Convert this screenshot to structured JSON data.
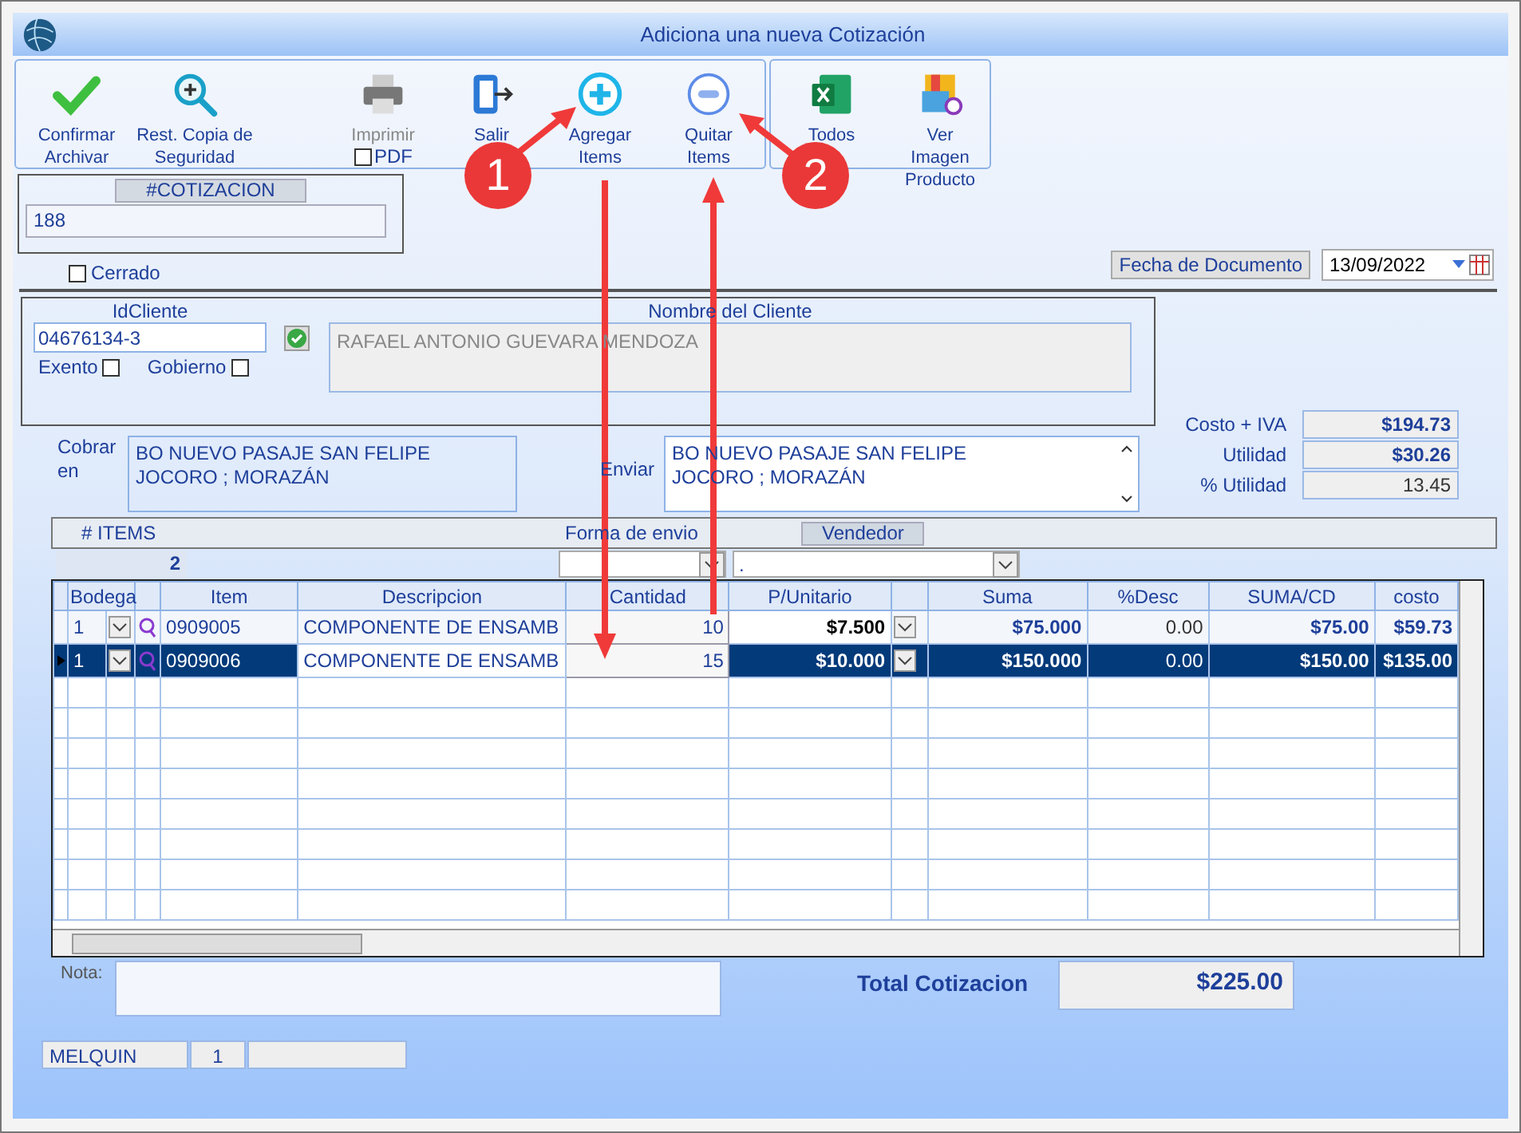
{
  "window": {
    "title": "Adiciona una nueva Cotización"
  },
  "toolbar": {
    "groups": [
      {
        "buttons": [
          {
            "label": "Confirmar Archivar",
            "disabled": false
          },
          {
            "label": "Rest. Copia de Seguridad",
            "disabled": false
          },
          {
            "label": "Imprimir",
            "disabled": true,
            "checkbox": {
              "label": "PDF",
              "checked": false
            }
          },
          {
            "label": "Salir",
            "disabled": false
          },
          {
            "label": "Agregar Items",
            "disabled": false
          },
          {
            "label": "Quitar Items",
            "disabled": false
          }
        ]
      },
      {
        "buttons": [
          {
            "label": "Todos",
            "disabled": false
          },
          {
            "label": "Ver Imagen Producto",
            "disabled": false
          }
        ]
      }
    ]
  },
  "cotizacion": {
    "label": "#COTIZACION",
    "value": "188"
  },
  "cerrado": {
    "label": "Cerrado",
    "checked": false
  },
  "fecha": {
    "label": "Fecha de  Documento",
    "value": "13/09/2022"
  },
  "cliente": {
    "id_label": "IdCliente",
    "id": "04676134-3",
    "exento": {
      "label": "Exento",
      "checked": false
    },
    "gobierno": {
      "label": "Gobierno",
      "checked": false
    },
    "name_label": "Nombre del Cliente",
    "name": "RAFAEL ANTONIO GUEVARA MENDOZA"
  },
  "summary": [
    {
      "label": "Costo + IVA",
      "value": "$194.73",
      "bold": true
    },
    {
      "label": "Utilidad",
      "value": "$30.26",
      "bold": true
    },
    {
      "label": "% Utilidad",
      "value": "13.45",
      "bold": false
    }
  ],
  "cobrar": {
    "label": "Cobrar en",
    "lines": [
      "BO NUEVO PASAJE SAN FELIPE",
      "JOCORO ; MORAZÁN"
    ]
  },
  "enviar": {
    "label": "Enviar",
    "lines": [
      "BO NUEVO PASAJE SAN FELIPE",
      "JOCORO ; MORAZÁN"
    ]
  },
  "items_bar": {
    "items_label": "# ITEMS",
    "items_count": "2",
    "forma_envio_label": "Forma de envio",
    "vendedor_label": "Vendedor",
    "vendedor_value": "."
  },
  "grid": {
    "columns": [
      "Bodega",
      "Item",
      "Descripcion",
      "Cantidad",
      "P/Unitario",
      "Suma",
      "%Desc",
      "SUMA/CD",
      "costo"
    ],
    "rows": [
      {
        "selected": false,
        "bodega": "1",
        "item": "0909005",
        "descripcion": "COMPONENTE DE ENSAMB",
        "cantidad": "10",
        "p_unitario": "$7.500",
        "suma": "$75.000",
        "desc": "0.00",
        "suma_cd": "$75.00",
        "costo": "$59.73"
      },
      {
        "selected": true,
        "bodega": "1",
        "item": "0909006",
        "descripcion": "COMPONENTE DE ENSAMB",
        "cantidad": "15",
        "p_unitario": "$10.000",
        "suma": "$150.000",
        "desc": "0.00",
        "suma_cd": "$150.00",
        "costo": "$135.00"
      }
    ]
  },
  "nota": {
    "label": "Nota:"
  },
  "total": {
    "label": "Total Cotizacion",
    "value": "$225.00"
  },
  "status": [
    "MELQUIN",
    "1"
  ],
  "annotations": [
    {
      "number": "1"
    },
    {
      "number": "2"
    }
  ]
}
